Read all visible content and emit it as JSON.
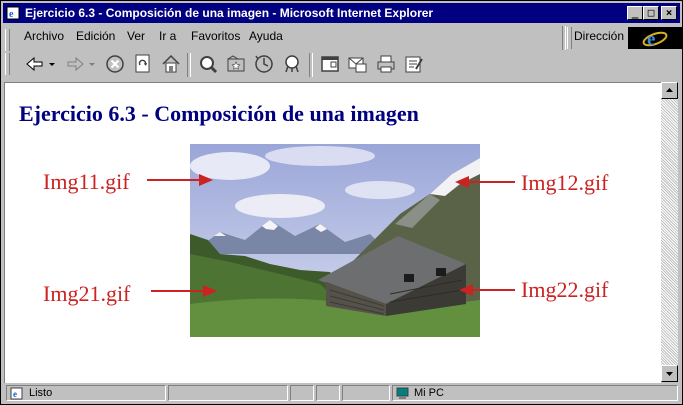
{
  "window": {
    "title": "Ejercicio 6.3 - Composición de una imagen - Microsoft Internet Explorer",
    "minimize": "_",
    "maximize": "□",
    "close": "×"
  },
  "menu": {
    "items": [
      {
        "label": "Archivo"
      },
      {
        "label": "Edición"
      },
      {
        "label": "Ver"
      },
      {
        "label": "Ir a"
      },
      {
        "label": "Favoritos"
      },
      {
        "label": "Ayuda"
      }
    ],
    "address_label": "Dirección"
  },
  "toolbar": {
    "icons": [
      "back-icon",
      "forward-icon",
      "stop-icon",
      "refresh-icon",
      "home-icon",
      "search-icon",
      "favorites-icon",
      "history-icon",
      "channels-icon",
      "fullscreen-icon",
      "mail-icon",
      "print-icon",
      "edit-icon"
    ]
  },
  "page": {
    "heading": "Ejercicio 6.3 - Composición de una imagen",
    "labels": {
      "top_left": "Img11.gif",
      "top_right": "Img12.gif",
      "bottom_left": "Img21.gif",
      "bottom_right": "Img22.gif"
    }
  },
  "status": {
    "text": "Listo",
    "zone": "Mi PC"
  },
  "colors": {
    "titlebar": "#000080",
    "heading": "#000080",
    "labels": "#cc2222"
  }
}
